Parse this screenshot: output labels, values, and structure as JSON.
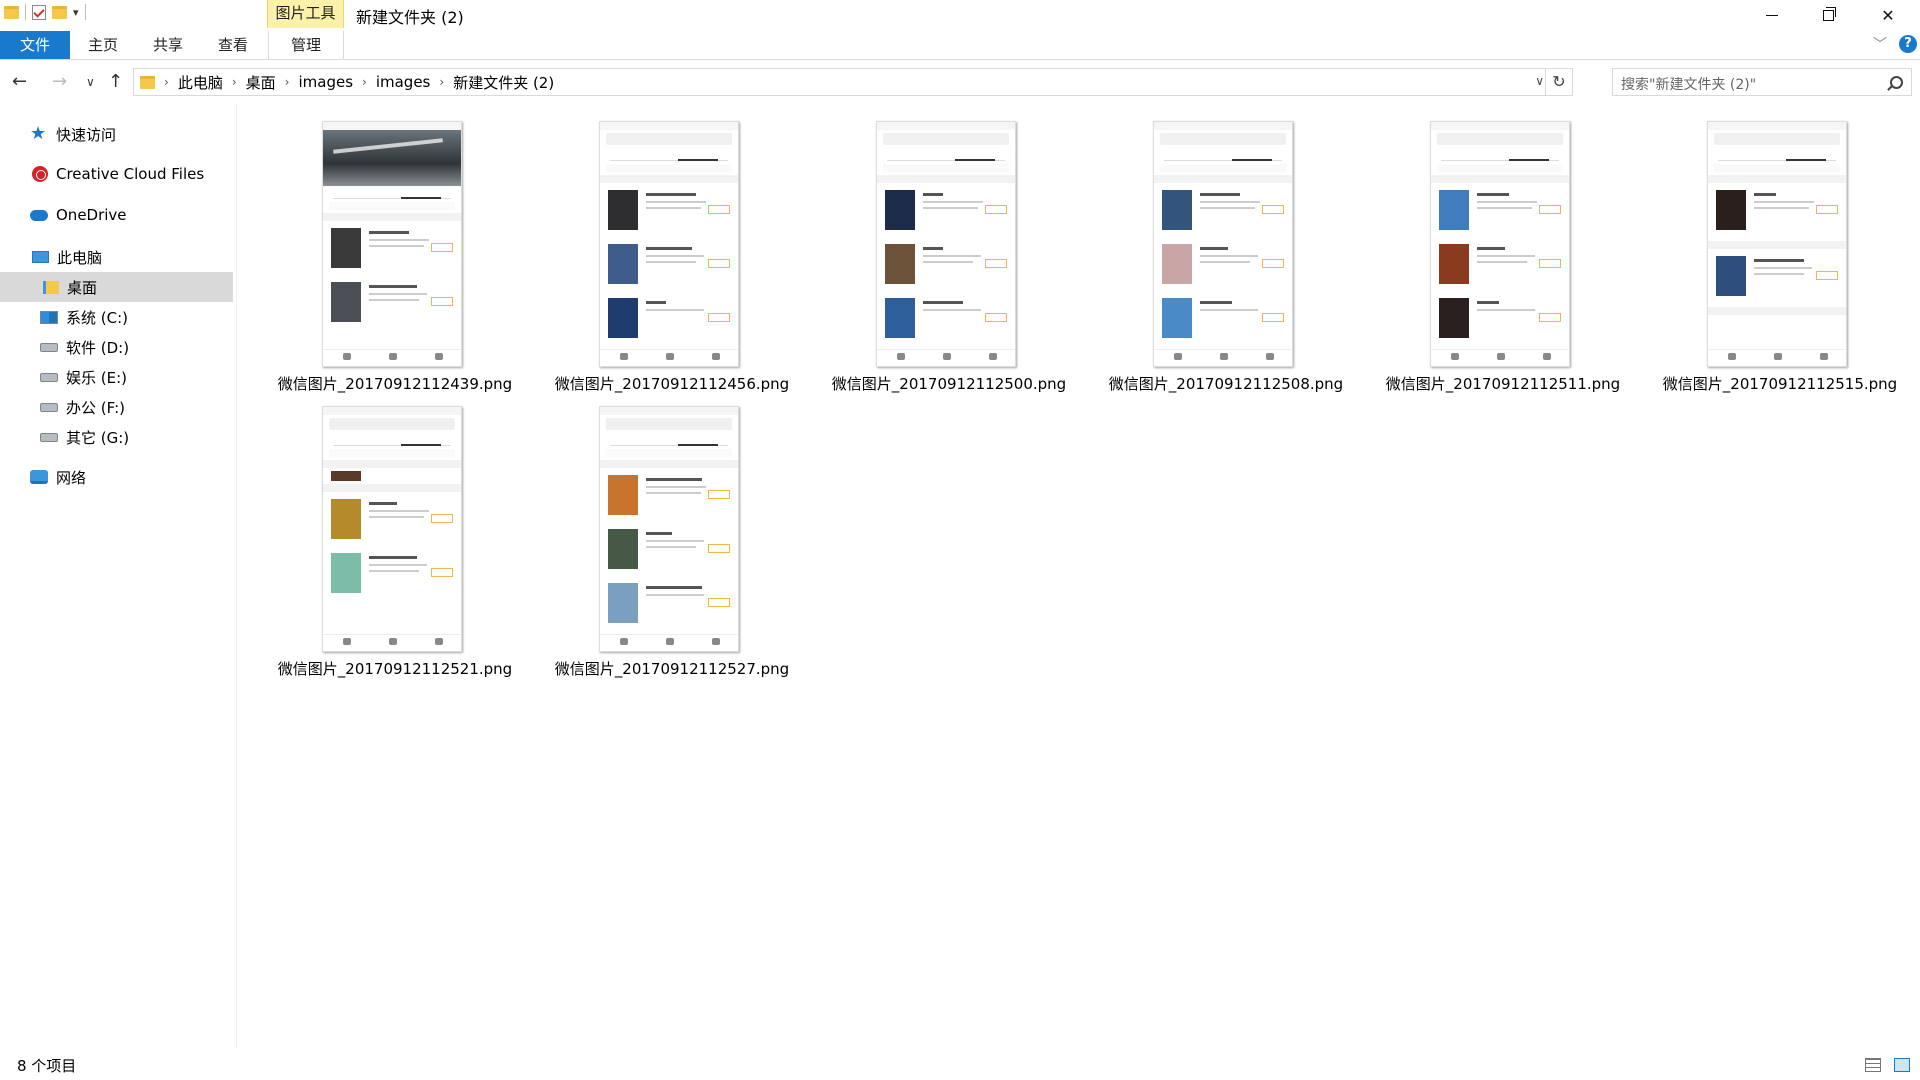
{
  "titlebar": {
    "context_tab": "图片工具",
    "title": "新建文件夹 (2)"
  },
  "ribbon": {
    "file": "文件",
    "home": "主页",
    "share": "共享",
    "view": "查看",
    "manage": "管理"
  },
  "address": {
    "crumbs": [
      "此电脑",
      "桌面",
      "images",
      "images",
      "新建文件夹 (2)"
    ],
    "search_placeholder": "搜索\"新建文件夹 (2)\""
  },
  "sidebar": {
    "items": [
      {
        "label": "快速访问",
        "icon": "star-icon"
      },
      {
        "label": "Creative Cloud Files",
        "icon": "creative-cloud-icon"
      },
      {
        "label": "OneDrive",
        "icon": "cloud-icon"
      },
      {
        "label": "此电脑",
        "icon": "computer-icon"
      },
      {
        "label": "桌面",
        "icon": "desktop-icon",
        "selected": true
      },
      {
        "label": "系统 (C:)",
        "icon": "drive-icon"
      },
      {
        "label": "软件 (D:)",
        "icon": "drive-icon"
      },
      {
        "label": "娱乐 (E:)",
        "icon": "drive-icon"
      },
      {
        "label": "办公 (F:)",
        "icon": "drive-icon"
      },
      {
        "label": "其它 (G:)",
        "icon": "drive-icon"
      },
      {
        "label": "网络",
        "icon": "network-icon"
      }
    ]
  },
  "files": [
    {
      "name": "微信图片_20170912112439.png"
    },
    {
      "name": "微信图片_20170912112456.png"
    },
    {
      "name": "微信图片_20170912112500.png"
    },
    {
      "name": "微信图片_20170912112508.png"
    },
    {
      "name": "微信图片_20170912112511.png"
    },
    {
      "name": "微信图片_20170912112515.png"
    },
    {
      "name": "微信图片_20170912112521.png"
    },
    {
      "name": "微信图片_20170912112527.png"
    }
  ],
  "status": {
    "count": "8 个项目"
  },
  "colors": {
    "accent": "#1979ca",
    "context_tab": "#fbf1a8",
    "selected_bg": "#d9d9d9"
  }
}
